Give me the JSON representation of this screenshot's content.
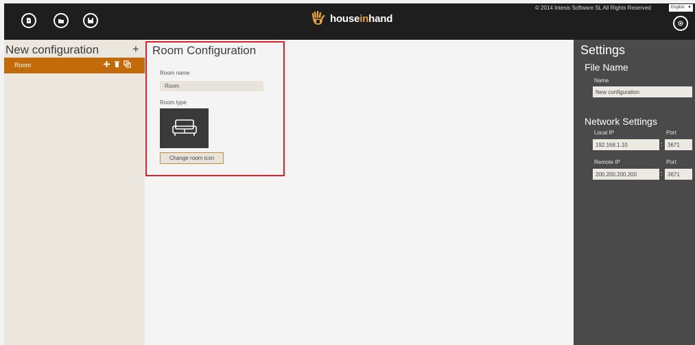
{
  "header": {
    "copyright": "© 2014 Intesis Software SL All Rights Reserved",
    "language": "English",
    "logo_plain": "house",
    "logo_accent": "in",
    "logo_end": "hand"
  },
  "icons": {
    "new_file": "new-file-icon",
    "open_folder": "folder-icon",
    "save": "save-icon",
    "settings": "gear-icon",
    "logo": "hand-logo-icon",
    "add": "plus-icon",
    "delete": "trash-icon",
    "duplicate": "copy-icon",
    "sofa": "sofa-icon"
  },
  "left_panel": {
    "title": "New configuration",
    "add_label": "+",
    "items": [
      {
        "label": "Room"
      }
    ]
  },
  "main": {
    "title": "Room Configuration",
    "room_name_label": "Room name",
    "room_name_value": "Room",
    "room_type_label": "Room type",
    "change_icon_button": "Change room icon"
  },
  "settings": {
    "title": "Settings",
    "file_name_heading": "File Name",
    "name_label": "Name",
    "name_value": "New configuration",
    "network_heading": "Network Settings",
    "local_ip_label": "Local IP",
    "local_ip_value": "192.168.1.10",
    "local_port_label": "Port",
    "local_port_value": "3671",
    "remote_ip_label": "Remote IP",
    "remote_ip_value": "200.200.200.200",
    "remote_port_label": "Port",
    "remote_port_value": "3671",
    "colon": ":"
  },
  "colors": {
    "accent": "#c16b0a",
    "topbar": "#1e1e1e",
    "highlight": "#e31e24",
    "settings_bg": "#4a4a4a"
  }
}
